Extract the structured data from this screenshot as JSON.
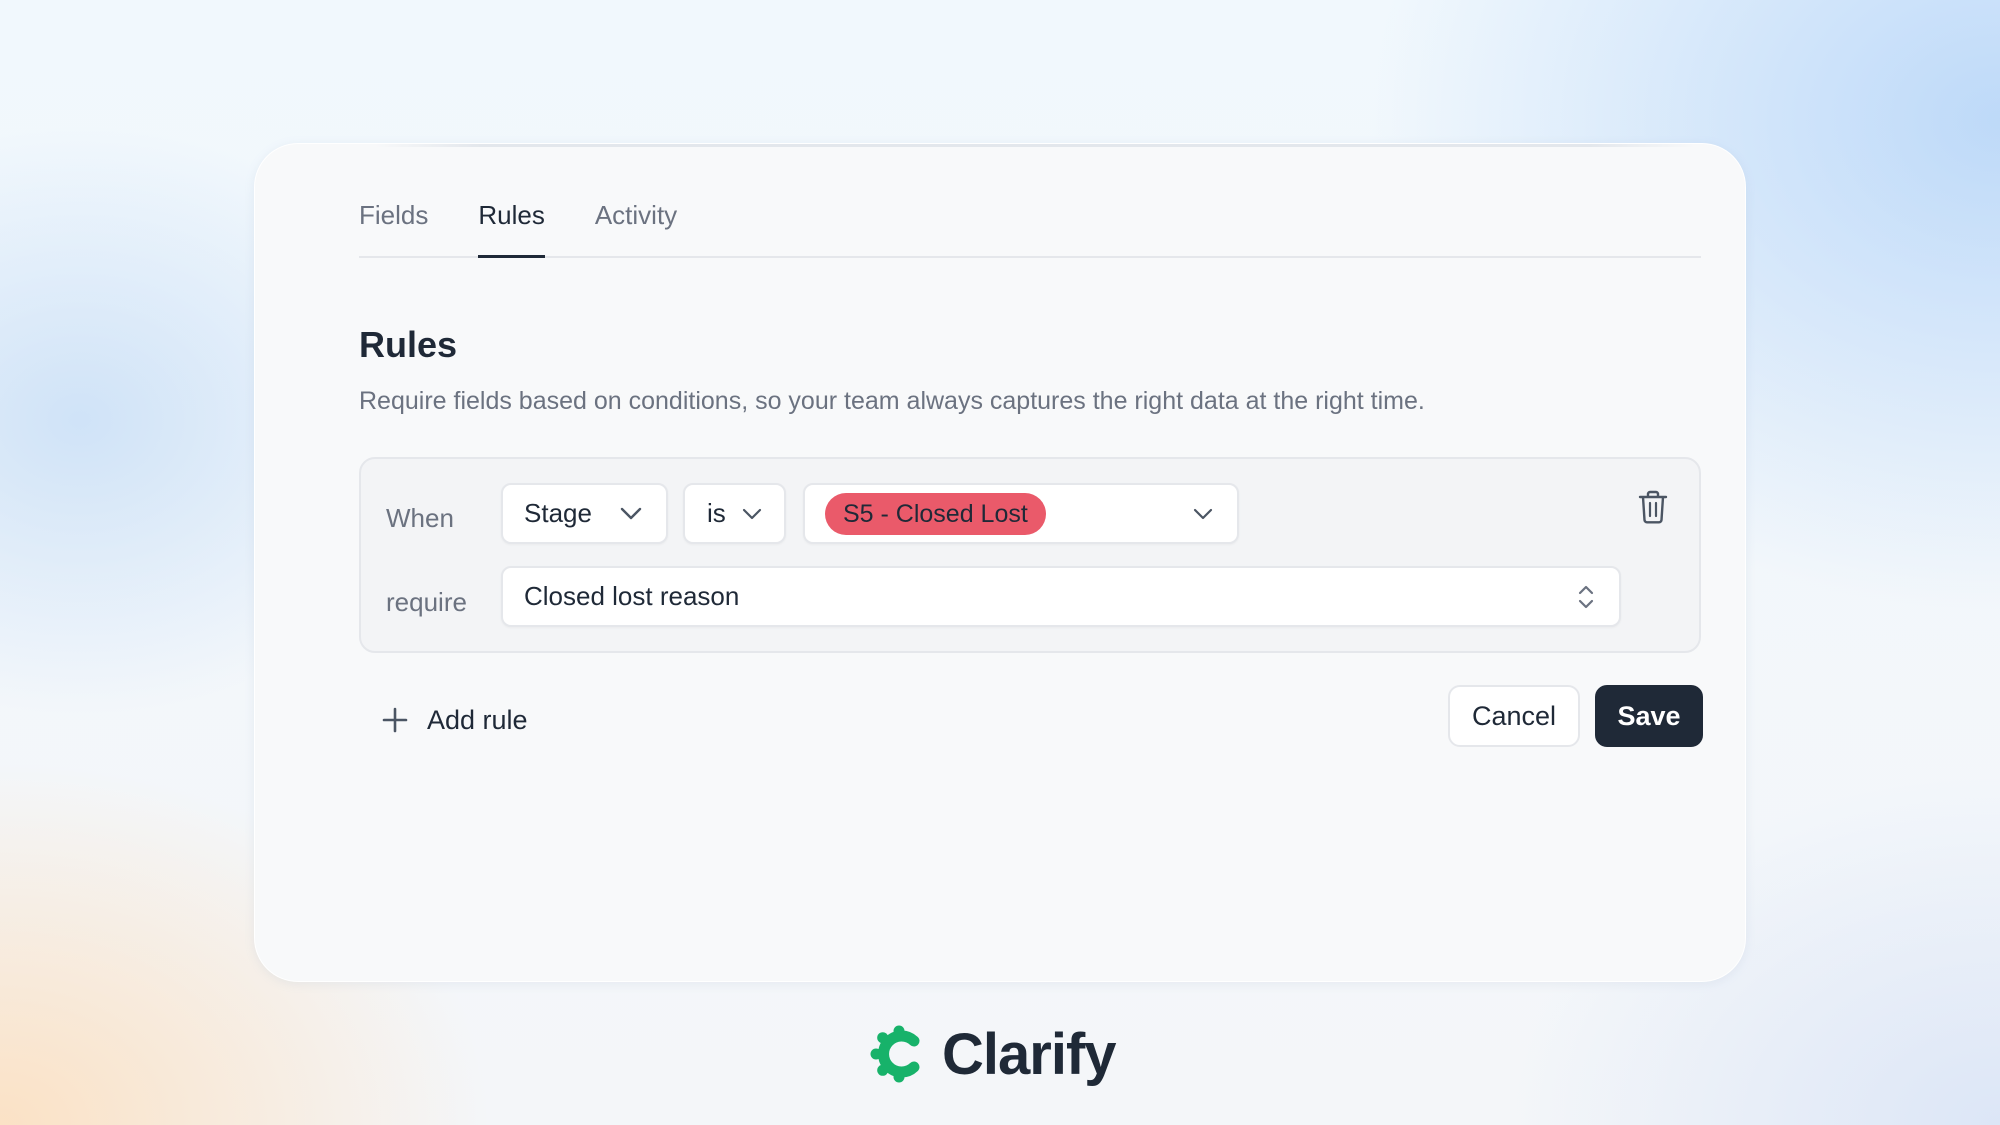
{
  "tabs": [
    {
      "label": "Fields",
      "active": false
    },
    {
      "label": "Rules",
      "active": true
    },
    {
      "label": "Activity",
      "active": false
    }
  ],
  "rules_section": {
    "title": "Rules",
    "description": "Require fields based on conditions, so your team always captures the right data at the right time."
  },
  "rule": {
    "when_label": "When",
    "field_value": "Stage",
    "operator_value": "is",
    "condition_value": "S5 - Closed Lost",
    "require_label": "require",
    "required_field_value": "Closed lost reason"
  },
  "actions": {
    "add_rule_label": "Add rule",
    "cancel_label": "Cancel",
    "save_label": "Save"
  },
  "brand": {
    "name": "Clarify",
    "logo_color": "#17b26a"
  },
  "colors": {
    "pill_background": "#ea5a6a",
    "primary_button": "#1f2937"
  },
  "icons": {
    "trash": "trash-icon",
    "chevron": "chevron-down-icon",
    "sort": "chevron-up-down-icon",
    "plus": "plus-icon",
    "logo": "clarify-logo-icon"
  }
}
